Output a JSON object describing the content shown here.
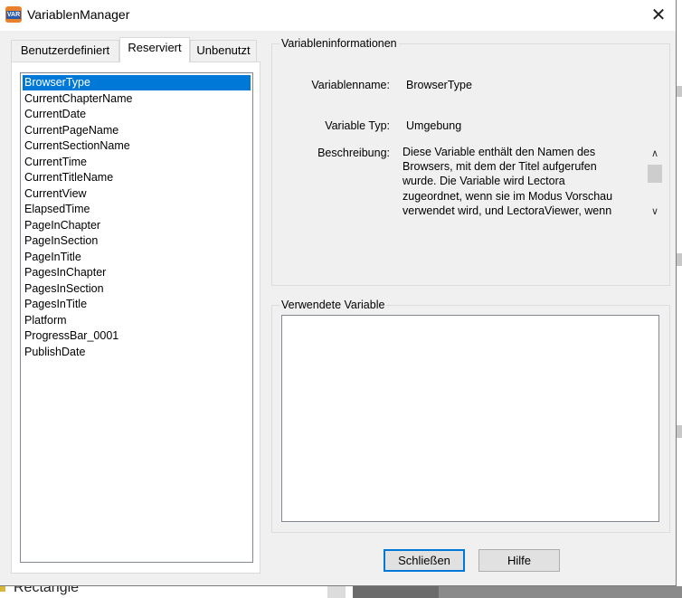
{
  "window": {
    "title": "VariablenManager",
    "icon_label": "VAR",
    "close_glyph": "✕"
  },
  "tabs": [
    {
      "label": "Benutzerdefiniert",
      "active": false
    },
    {
      "label": "Reserviert",
      "active": true
    },
    {
      "label": "Unbenutzt",
      "active": false
    }
  ],
  "variables": [
    "BrowserType",
    "CurrentChapterName",
    "CurrentDate",
    "CurrentPageName",
    "CurrentSectionName",
    "CurrentTime",
    "CurrentTitleName",
    "CurrentView",
    "ElapsedTime",
    "PageInChapter",
    "PageInSection",
    "PageInTitle",
    "PagesInChapter",
    "PagesInSection",
    "PagesInTitle",
    "Platform",
    "ProgressBar_0001",
    "PublishDate"
  ],
  "selected_variable": "BrowserType",
  "info": {
    "group_title": "Variableninformationen",
    "name_label": "Variablenname:",
    "name_value": "BrowserType",
    "type_label": "Variable Typ:",
    "type_value": "Umgebung",
    "desc_label": "Beschreibung:",
    "desc_lines": [
      "Diese Variable enthält den Namen des",
      "Browsers, mit dem der Titel aufgerufen",
      "wurde. Die Variable wird Lectora",
      "zugeordnet, wenn sie im Modus Vorschau",
      "verwendet wird, und LectoraViewer, wenn"
    ]
  },
  "used": {
    "group_title": "Verwendete Variable"
  },
  "buttons": {
    "close_label": "Schließen",
    "help_label": "Hilfe"
  },
  "background": {
    "label": "Rectangle"
  },
  "colors": {
    "selection": "#0078d7",
    "focus_border": "#0078d7"
  }
}
